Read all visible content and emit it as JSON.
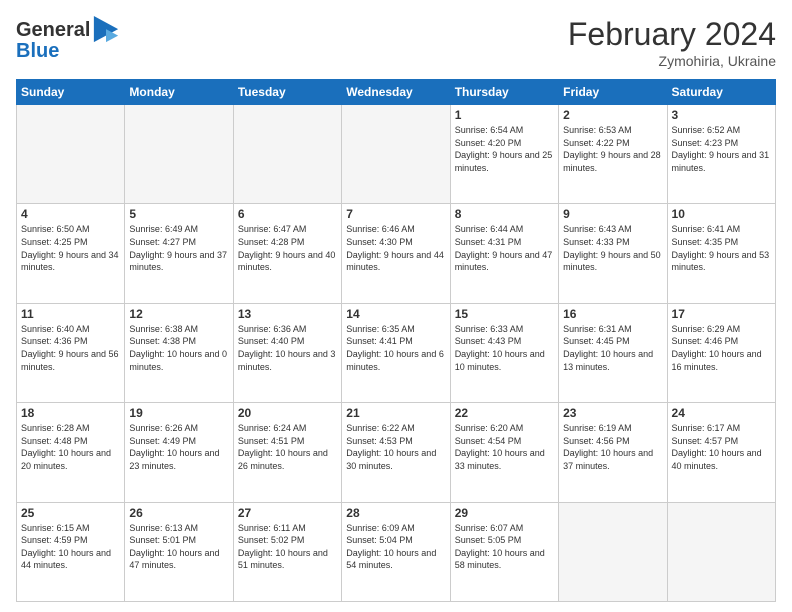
{
  "header": {
    "logo_line1": "General",
    "logo_line2": "Blue",
    "month_year": "February 2024",
    "location": "Zymohiria, Ukraine"
  },
  "days_of_week": [
    "Sunday",
    "Monday",
    "Tuesday",
    "Wednesday",
    "Thursday",
    "Friday",
    "Saturday"
  ],
  "weeks": [
    [
      {
        "day": "",
        "info": ""
      },
      {
        "day": "",
        "info": ""
      },
      {
        "day": "",
        "info": ""
      },
      {
        "day": "",
        "info": ""
      },
      {
        "day": "1",
        "info": "Sunrise: 6:54 AM\nSunset: 4:20 PM\nDaylight: 9 hours and 25 minutes."
      },
      {
        "day": "2",
        "info": "Sunrise: 6:53 AM\nSunset: 4:22 PM\nDaylight: 9 hours and 28 minutes."
      },
      {
        "day": "3",
        "info": "Sunrise: 6:52 AM\nSunset: 4:23 PM\nDaylight: 9 hours and 31 minutes."
      }
    ],
    [
      {
        "day": "4",
        "info": "Sunrise: 6:50 AM\nSunset: 4:25 PM\nDaylight: 9 hours and 34 minutes."
      },
      {
        "day": "5",
        "info": "Sunrise: 6:49 AM\nSunset: 4:27 PM\nDaylight: 9 hours and 37 minutes."
      },
      {
        "day": "6",
        "info": "Sunrise: 6:47 AM\nSunset: 4:28 PM\nDaylight: 9 hours and 40 minutes."
      },
      {
        "day": "7",
        "info": "Sunrise: 6:46 AM\nSunset: 4:30 PM\nDaylight: 9 hours and 44 minutes."
      },
      {
        "day": "8",
        "info": "Sunrise: 6:44 AM\nSunset: 4:31 PM\nDaylight: 9 hours and 47 minutes."
      },
      {
        "day": "9",
        "info": "Sunrise: 6:43 AM\nSunset: 4:33 PM\nDaylight: 9 hours and 50 minutes."
      },
      {
        "day": "10",
        "info": "Sunrise: 6:41 AM\nSunset: 4:35 PM\nDaylight: 9 hours and 53 minutes."
      }
    ],
    [
      {
        "day": "11",
        "info": "Sunrise: 6:40 AM\nSunset: 4:36 PM\nDaylight: 9 hours and 56 minutes."
      },
      {
        "day": "12",
        "info": "Sunrise: 6:38 AM\nSunset: 4:38 PM\nDaylight: 10 hours and 0 minutes."
      },
      {
        "day": "13",
        "info": "Sunrise: 6:36 AM\nSunset: 4:40 PM\nDaylight: 10 hours and 3 minutes."
      },
      {
        "day": "14",
        "info": "Sunrise: 6:35 AM\nSunset: 4:41 PM\nDaylight: 10 hours and 6 minutes."
      },
      {
        "day": "15",
        "info": "Sunrise: 6:33 AM\nSunset: 4:43 PM\nDaylight: 10 hours and 10 minutes."
      },
      {
        "day": "16",
        "info": "Sunrise: 6:31 AM\nSunset: 4:45 PM\nDaylight: 10 hours and 13 minutes."
      },
      {
        "day": "17",
        "info": "Sunrise: 6:29 AM\nSunset: 4:46 PM\nDaylight: 10 hours and 16 minutes."
      }
    ],
    [
      {
        "day": "18",
        "info": "Sunrise: 6:28 AM\nSunset: 4:48 PM\nDaylight: 10 hours and 20 minutes."
      },
      {
        "day": "19",
        "info": "Sunrise: 6:26 AM\nSunset: 4:49 PM\nDaylight: 10 hours and 23 minutes."
      },
      {
        "day": "20",
        "info": "Sunrise: 6:24 AM\nSunset: 4:51 PM\nDaylight: 10 hours and 26 minutes."
      },
      {
        "day": "21",
        "info": "Sunrise: 6:22 AM\nSunset: 4:53 PM\nDaylight: 10 hours and 30 minutes."
      },
      {
        "day": "22",
        "info": "Sunrise: 6:20 AM\nSunset: 4:54 PM\nDaylight: 10 hours and 33 minutes."
      },
      {
        "day": "23",
        "info": "Sunrise: 6:19 AM\nSunset: 4:56 PM\nDaylight: 10 hours and 37 minutes."
      },
      {
        "day": "24",
        "info": "Sunrise: 6:17 AM\nSunset: 4:57 PM\nDaylight: 10 hours and 40 minutes."
      }
    ],
    [
      {
        "day": "25",
        "info": "Sunrise: 6:15 AM\nSunset: 4:59 PM\nDaylight: 10 hours and 44 minutes."
      },
      {
        "day": "26",
        "info": "Sunrise: 6:13 AM\nSunset: 5:01 PM\nDaylight: 10 hours and 47 minutes."
      },
      {
        "day": "27",
        "info": "Sunrise: 6:11 AM\nSunset: 5:02 PM\nDaylight: 10 hours and 51 minutes."
      },
      {
        "day": "28",
        "info": "Sunrise: 6:09 AM\nSunset: 5:04 PM\nDaylight: 10 hours and 54 minutes."
      },
      {
        "day": "29",
        "info": "Sunrise: 6:07 AM\nSunset: 5:05 PM\nDaylight: 10 hours and 58 minutes."
      },
      {
        "day": "",
        "info": ""
      },
      {
        "day": "",
        "info": ""
      }
    ]
  ]
}
